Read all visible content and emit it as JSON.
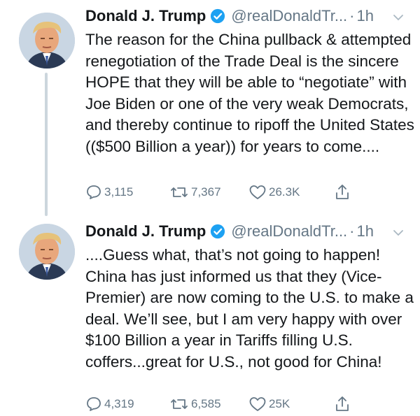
{
  "tweets": [
    {
      "author_name": "Donald J. Trump",
      "handle": "@realDonaldTr...",
      "separator": "·",
      "time": "1h",
      "text": "The reason for the China pullback & attempted renegotiation of the Trade Deal is the sincere HOPE that they will be able to “negotiate” with Joe Biden or one of the very weak Democrats, and thereby continue to ripoff the United States (($500 Billion a year)) for years to come....",
      "replies": "3,115",
      "retweets": "7,367",
      "likes": "26.3K",
      "icons": [
        "reply-icon",
        "retweet-icon",
        "like-icon",
        "share-icon"
      ]
    },
    {
      "author_name": "Donald J. Trump",
      "handle": "@realDonaldTr...",
      "separator": "·",
      "time": "1h",
      "text": "....Guess what, that’s not going to happen! China has just informed us that they (Vice-Premier) are now coming to the U.S. to make a deal. We’ll see, but I am very happy with over $100 Billion a year in Tariffs filling U.S. coffers...great for U.S., not good for China!",
      "replies": "4,319",
      "retweets": "6,585",
      "likes": "25K",
      "icons": [
        "reply-icon",
        "retweet-icon",
        "like-icon",
        "share-icon"
      ]
    }
  ],
  "colors": {
    "text": "#14171a",
    "secondary": "#657786",
    "verified": "#1da1f2",
    "thread_line": "#ccd6dd"
  }
}
